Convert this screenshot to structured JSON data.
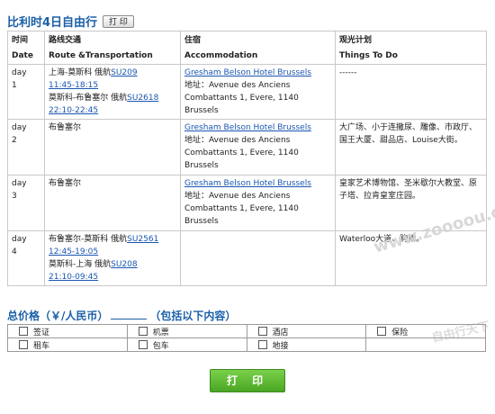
{
  "header": {
    "title": "比利时4日自由行",
    "print_small_label": "打 印"
  },
  "table": {
    "columns": [
      {
        "cn": "时间",
        "en": "Date"
      },
      {
        "cn": "路线交通",
        "en": "Route &Transportation"
      },
      {
        "cn": "住宿",
        "en": "Accommodation"
      },
      {
        "cn": "观光计划",
        "en": "Things To Do"
      }
    ],
    "rows": [
      {
        "day": "day",
        "day_num": "1",
        "route": [
          {
            "text": "上海-莫斯科 俄航",
            "link": "SU209",
            "time": "11:45-18:15"
          },
          {
            "text": "莫斯科-布鲁塞尔 俄航",
            "link": "SU2618",
            "time": "22:10-22:45"
          }
        ],
        "hotel_name": "Gresham Belson Hotel Brussels",
        "hotel_addr": "地址：Avenue des Anciens Combattants 1, Evere, 1140 Brussels",
        "todo": "------"
      },
      {
        "day": "day",
        "day_num": "2",
        "route_text": "布鲁塞尔",
        "hotel_name": "Gresham Belson Hotel Brussels",
        "hotel_addr": "地址：Avenue des Anciens Combattants 1, Evere, 1140 Brussels",
        "todo": "大广场、小于连撒尿、雕像、市政厅、国王大厦、甜品店、Louise大街。"
      },
      {
        "day": "day",
        "day_num": "3",
        "route_text": "布鲁塞尔",
        "hotel_name": "Gresham Belson Hotel Brussels",
        "hotel_addr": "地址：Avenue des Anciens Combattants 1, Evere, 1140 Brussels",
        "todo": "皇家艺术博物馆、圣米歇尔大教堂、原子塔、拉肯皇室庄园。"
      },
      {
        "day": "day",
        "day_num": "4",
        "route": [
          {
            "text": "布鲁塞尔-莫斯科 俄航",
            "link": "SU2561",
            "time": "12:45-19:05"
          },
          {
            "text": "莫斯科-上海 俄航",
            "link": "SU208",
            "time": "21:10-09:45"
          }
        ],
        "todo": "Waterloo大道、购物。"
      }
    ]
  },
  "watermark": {
    "main": "www.zoooou.com",
    "sub": "自由行天下"
  },
  "price": {
    "label_left": "总价格（￥/人民币）",
    "label_right": "（包括以下内容）"
  },
  "includes": [
    "签证",
    "机票",
    "酒店",
    "保险",
    "租车",
    "包车",
    "地接",
    ""
  ],
  "print_button_label": "打 印"
}
